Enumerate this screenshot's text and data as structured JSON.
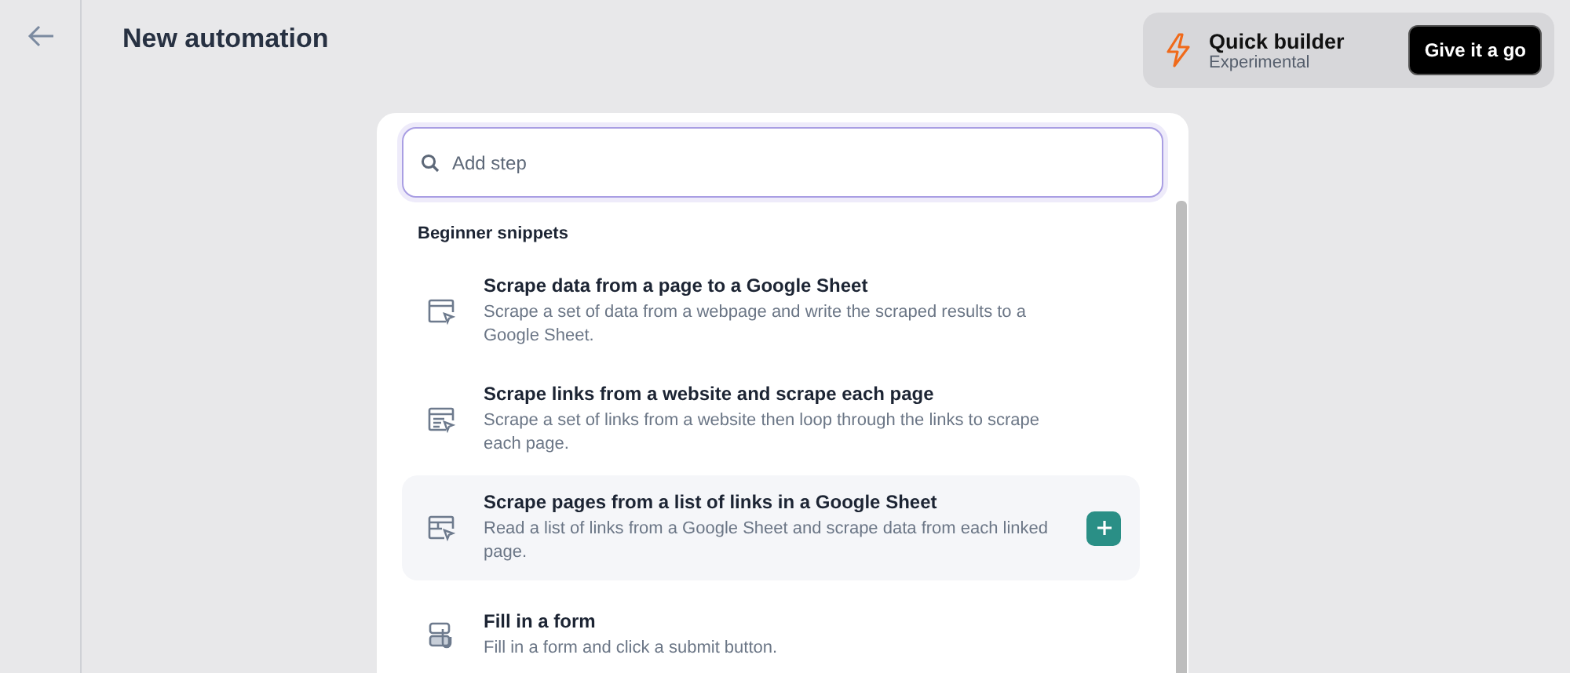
{
  "header": {
    "title": "New automation"
  },
  "quick_builder": {
    "title": "Quick builder",
    "subtitle": "Experimental",
    "button": "Give it a go"
  },
  "search": {
    "placeholder": "Add step"
  },
  "section": {
    "title": "Beginner snippets"
  },
  "snippets": [
    {
      "kind": "page",
      "title": "Scrape data from a page to a Google Sheet",
      "description": "Scrape a set of data from a webpage and write the scraped results to a Google Sheet.",
      "selected": false
    },
    {
      "kind": "links",
      "title": "Scrape links from a website and scrape each page",
      "description": "Scrape a set of links from a website then loop through the links to scrape each page.",
      "selected": false
    },
    {
      "kind": "sheet",
      "title": "Scrape pages from a list of links in a Google Sheet",
      "description": "Read a list of links from a Google Sheet and scrape data from each linked page.",
      "selected": true
    },
    {
      "kind": "form",
      "title": "Fill in a form",
      "description": "Fill in a form and click a submit button.",
      "selected": false
    }
  ]
}
